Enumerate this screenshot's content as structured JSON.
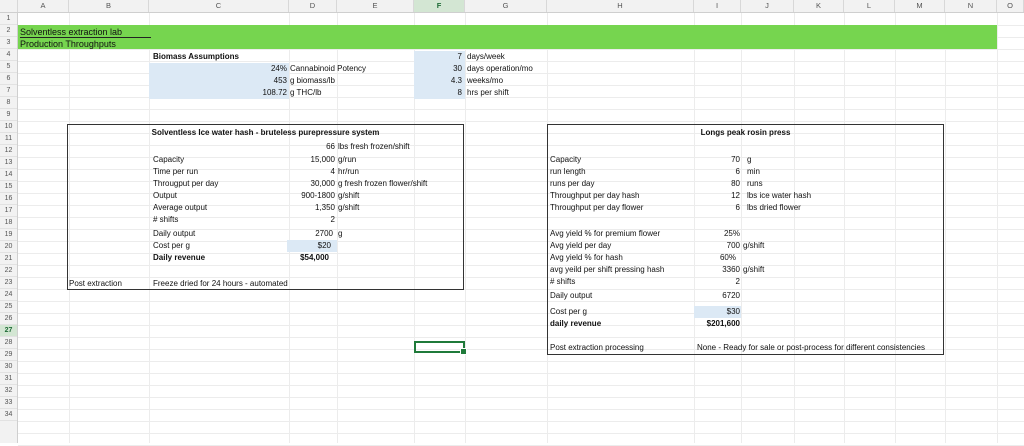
{
  "columns": [
    "A",
    "B",
    "C",
    "D",
    "E",
    "F",
    "G",
    "H",
    "I",
    "J",
    "K",
    "L",
    "M",
    "N",
    "O"
  ],
  "rows": [
    "1",
    "2",
    "3",
    "4",
    "5",
    "6",
    "7",
    "8",
    "9",
    "10",
    "11",
    "12",
    "13",
    "14",
    "15",
    "16",
    "17",
    "18",
    "19",
    "20",
    "21",
    "22",
    "23",
    "24",
    "25",
    "26",
    "27",
    "28",
    "29",
    "30",
    "31",
    "32",
    "33",
    "34"
  ],
  "selected_column": "F",
  "selected_row": "27",
  "colors": {
    "header_band": "#76d54f",
    "input_highlight": "#dce9f5",
    "selection": "#1f7a3a"
  },
  "header": {
    "title": "Solventless extraction lab",
    "subtitle": "Production Throughputs"
  },
  "biomass": {
    "heading": "Biomass Assumptions",
    "rows": [
      {
        "value": "24%",
        "label": "Cannabinoid Potency"
      },
      {
        "value": "453",
        "label": "g biomass/lb"
      },
      {
        "value": "108.72",
        "label": "g THC/lb"
      }
    ]
  },
  "schedule": {
    "rows": [
      {
        "value": "7",
        "label": "days/week"
      },
      {
        "value": "30",
        "label": "days operation/mo"
      },
      {
        "value": "4.3",
        "label": "weeks/mo"
      },
      {
        "value": "8",
        "label": "hrs per shift"
      }
    ]
  },
  "ice_water": {
    "title": "Solventless Ice water hash - bruteless purepressure system",
    "top_value": "66",
    "top_unit": "lbs fresh frozen/shift",
    "rows": [
      {
        "label": "Capacity",
        "value": "15,000",
        "unit": "g/run"
      },
      {
        "label": "Time per run",
        "value": "4",
        "unit": "hr/run"
      },
      {
        "label": "Througput per day",
        "value": "30,000",
        "unit": "g fresh frozen flower/shift"
      },
      {
        "label": "Output",
        "value": "900-1800",
        "unit": "g/shift"
      },
      {
        "label": "Average output",
        "value": "1,350",
        "unit": "g/shift"
      },
      {
        "label": "# shifts",
        "value": "2",
        "unit": ""
      },
      {
        "label": "Daily output",
        "value": "2700",
        "unit": "g"
      },
      {
        "label": "Cost per g",
        "value": "$20",
        "unit": ""
      },
      {
        "label": "Daily revenue",
        "value": "$54,000",
        "unit": ""
      }
    ],
    "post_label": "Post extraction",
    "post_value": "Freeze dried for 24 hours - automated"
  },
  "rosin": {
    "title": "Longs peak rosin press",
    "rows": [
      {
        "label": "Capacity",
        "value": "70",
        "unit": "g"
      },
      {
        "label": "run length",
        "value": "6",
        "unit": "min"
      },
      {
        "label": "runs per day",
        "value": "80",
        "unit": "runs"
      },
      {
        "label": "Throughput per day hash",
        "value": "12",
        "unit": "lbs ice water hash"
      },
      {
        "label": "Throughput per day flower",
        "value": "6",
        "unit": "lbs dried flower"
      },
      {
        "label": "Avg yield % for premium flower",
        "value": "25%",
        "unit": ""
      },
      {
        "label": "Avg yield per day",
        "value": "700",
        "unit": "g/shift"
      },
      {
        "label": "Avg yield % for hash",
        "value": "60%",
        "unit": ""
      },
      {
        "label": "avg yeild per shift pressing hash",
        "value": "3360",
        "unit": "g/shift"
      },
      {
        "label": "# shifts",
        "value": "2",
        "unit": ""
      },
      {
        "label": "Daily output",
        "value": "6720",
        "unit": ""
      },
      {
        "label": "Cost per g",
        "value": "$30",
        "unit": ""
      },
      {
        "label": "daily revenue",
        "value": "$201,600",
        "unit": ""
      }
    ],
    "post_label": "Post extraction processing",
    "post_value": "None - Ready for sale or post-process for different consistencies"
  }
}
